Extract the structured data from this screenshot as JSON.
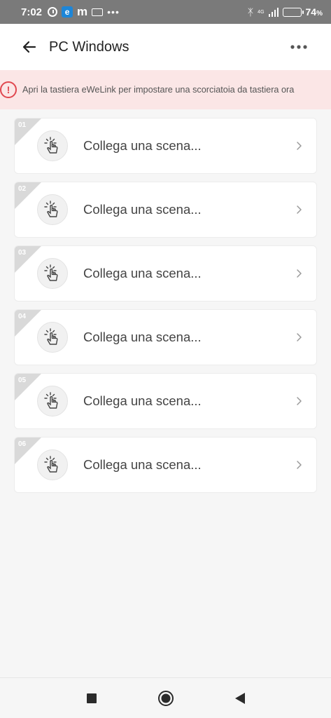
{
  "status_bar": {
    "time": "7:02",
    "battery_percent": "74",
    "battery_unit": "%",
    "battery_level": 0.74,
    "network": "4G",
    "dots": "•••"
  },
  "header": {
    "title": "PC Windows",
    "back_icon": "arrow-left-icon",
    "more_icon": "more-horizontal-icon"
  },
  "banner": {
    "icon": "alert-circle-icon",
    "icon_glyph": "!",
    "text": "Apri la tastiera eWeLink per impostare una scorciatoia da tastiera ora",
    "color": "#e0474f"
  },
  "shortcuts": [
    {
      "number": "01",
      "label": "Collega una scena..."
    },
    {
      "number": "02",
      "label": "Collega una scena..."
    },
    {
      "number": "03",
      "label": "Collega una scena..."
    },
    {
      "number": "04",
      "label": "Collega una scena..."
    },
    {
      "number": "05",
      "label": "Collega una scena..."
    },
    {
      "number": "06",
      "label": "Collega una scena..."
    }
  ],
  "nav": {
    "items": [
      "recent-apps-button",
      "home-button",
      "back-button"
    ]
  }
}
